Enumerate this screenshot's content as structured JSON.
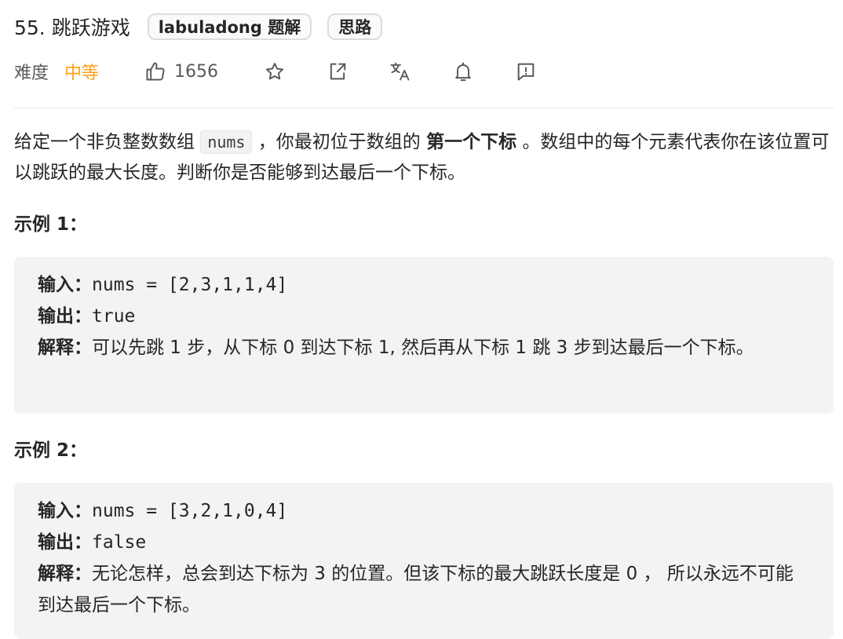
{
  "header": {
    "title": "55. 跳跃游戏",
    "tags": [
      "labuladong 题解",
      "思路"
    ]
  },
  "meta": {
    "difficulty_label": "难度",
    "difficulty_value": "中等",
    "like_count": "1656",
    "icons": [
      "thumbs-up-icon",
      "star-icon",
      "share-icon",
      "translate-icon",
      "bell-icon",
      "feedback-icon"
    ]
  },
  "description": {
    "part1": "给定一个非负整数数组",
    "code": "nums",
    "part2": "，你最初位于数组的",
    "bold": "第一个下标",
    "part3": "。数组中的每个元素代表你在该位置可以跳跃的最大长度。判断你是否能够到达最后一个下标。"
  },
  "examples": [
    {
      "heading": "示例 1：",
      "input_label": "输入：",
      "input_value": "nums = [2,3,1,1,4]",
      "output_label": "输出：",
      "output_value": "true",
      "explain_label": "解释：",
      "explain_value": "可以先跳 1 步，从下标 0 到达下标 1, 然后再从下标 1 跳 3 步到达最后一个下标。"
    },
    {
      "heading": "示例 2：",
      "input_label": "输入：",
      "input_value": "nums = [3,2,1,0,4]",
      "output_label": "输出：",
      "output_value": "false",
      "explain_label": "解释：",
      "explain_value": "无论怎样，总会到达下标为 3 的位置。但该下标的最大跳跃长度是 0 ， 所以永远不可能到达最后一个下标。"
    }
  ],
  "colors": {
    "difficulty": "#ffa116",
    "code_bg": "#f2f3f4"
  }
}
